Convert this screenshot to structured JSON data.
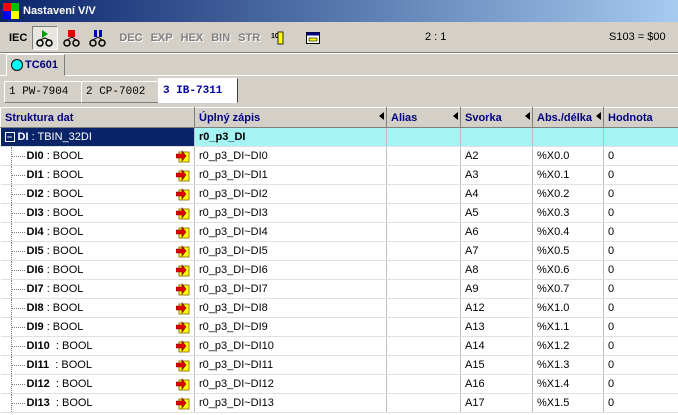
{
  "window": {
    "title": "Nastavení V/V"
  },
  "toolbar": {
    "iec": "IEC",
    "modes": [
      "DEC",
      "EXP",
      "HEX",
      "BIN",
      "STR"
    ],
    "ratio": "2 : 1",
    "status": "S103 = $00"
  },
  "top_tab": {
    "label": "TC601"
  },
  "sub_tabs": [
    {
      "label": "1 PW-7904",
      "active": false
    },
    {
      "label": "2 CP-7002",
      "active": false
    },
    {
      "label": "3 IB-7311",
      "active": true
    }
  ],
  "grid": {
    "headers": [
      "Struktura dat",
      "Úplný zápis",
      "Alias",
      "Svorka",
      "Abs./délka",
      "Hodnota"
    ],
    "group": {
      "name": "DI",
      "type": ": TBIN_32DI",
      "full": "r0_p3_DI"
    },
    "rows": [
      {
        "name": "DI0",
        "type": ": BOOL",
        "full": "r0_p3_DI~DI0",
        "alias": "",
        "svorka": "A2",
        "abs": "%X0.0",
        "value": "0"
      },
      {
        "name": "DI1",
        "type": ": BOOL",
        "full": "r0_p3_DI~DI1",
        "alias": "",
        "svorka": "A3",
        "abs": "%X0.1",
        "value": "0"
      },
      {
        "name": "DI2",
        "type": ": BOOL",
        "full": "r0_p3_DI~DI2",
        "alias": "",
        "svorka": "A4",
        "abs": "%X0.2",
        "value": "0"
      },
      {
        "name": "DI3",
        "type": ": BOOL",
        "full": "r0_p3_DI~DI3",
        "alias": "",
        "svorka": "A5",
        "abs": "%X0.3",
        "value": "0"
      },
      {
        "name": "DI4",
        "type": ": BOOL",
        "full": "r0_p3_DI~DI4",
        "alias": "",
        "svorka": "A6",
        "abs": "%X0.4",
        "value": "0"
      },
      {
        "name": "DI5",
        "type": ": BOOL",
        "full": "r0_p3_DI~DI5",
        "alias": "",
        "svorka": "A7",
        "abs": "%X0.5",
        "value": "0"
      },
      {
        "name": "DI6",
        "type": ": BOOL",
        "full": "r0_p3_DI~DI6",
        "alias": "",
        "svorka": "A8",
        "abs": "%X0.6",
        "value": "0"
      },
      {
        "name": "DI7",
        "type": ": BOOL",
        "full": "r0_p3_DI~DI7",
        "alias": "",
        "svorka": "A9",
        "abs": "%X0.7",
        "value": "0"
      },
      {
        "name": "DI8",
        "type": ": BOOL",
        "full": "r0_p3_DI~DI8",
        "alias": "",
        "svorka": "A12",
        "abs": "%X1.0",
        "value": "0"
      },
      {
        "name": "DI9",
        "type": ": BOOL",
        "full": "r0_p3_DI~DI9",
        "alias": "",
        "svorka": "A13",
        "abs": "%X1.1",
        "value": "0"
      },
      {
        "name": "DI10",
        "type": " : BOOL",
        "full": "r0_p3_DI~DI10",
        "alias": "",
        "svorka": "A14",
        "abs": "%X1.2",
        "value": "0"
      },
      {
        "name": "DI11",
        "type": " : BOOL",
        "full": "r0_p3_DI~DI11",
        "alias": "",
        "svorka": "A15",
        "abs": "%X1.3",
        "value": "0"
      },
      {
        "name": "DI12",
        "type": " : BOOL",
        "full": "r0_p3_DI~DI12",
        "alias": "",
        "svorka": "A16",
        "abs": "%X1.4",
        "value": "0"
      },
      {
        "name": "DI13",
        "type": " : BOOL",
        "full": "r0_p3_DI~DI13",
        "alias": "",
        "svorka": "A17",
        "abs": "%X1.5",
        "value": "0"
      }
    ]
  },
  "colors": {
    "title_start": "#0a246a",
    "title_end": "#a6caf0",
    "group_row": "#a6f5f5",
    "header_text": "#000080",
    "active_tab_text": "#0000aa"
  }
}
